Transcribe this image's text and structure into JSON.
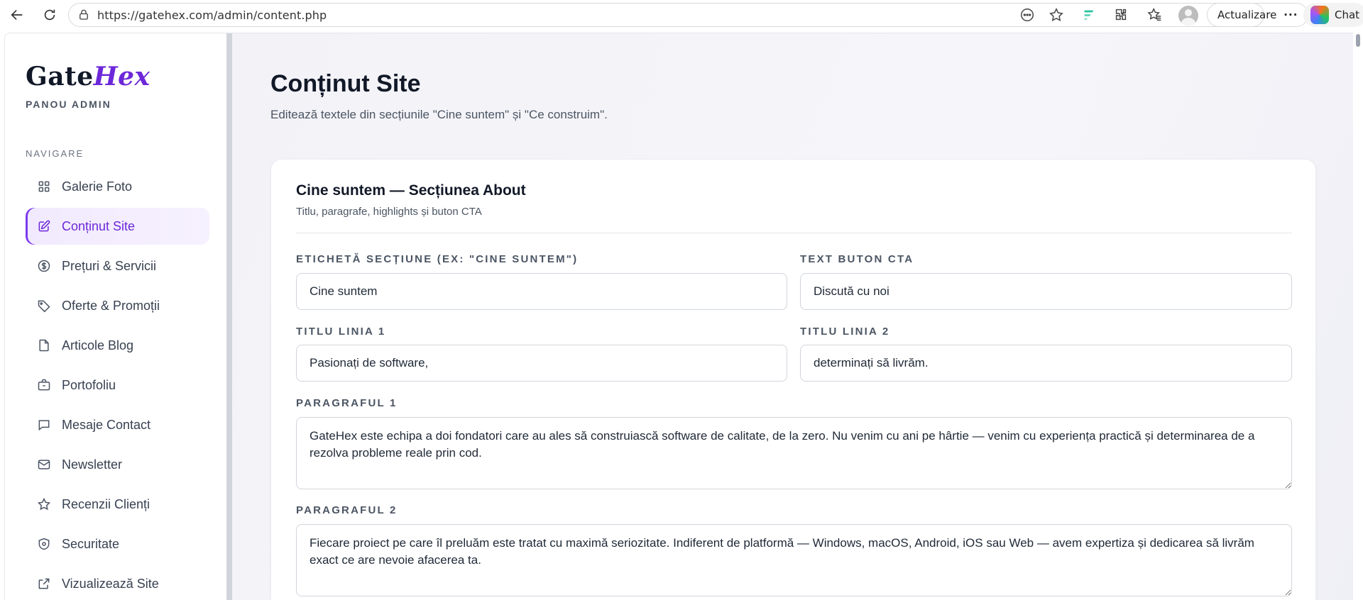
{
  "browser": {
    "url": "https://gatehex.com/admin/content.php",
    "update_label": "Actualizare",
    "update_more": "···",
    "chat_label": "Chat",
    "icons": [
      "back-icon",
      "reload-icon",
      "lock-icon",
      "reader-mode-icon",
      "star-icon",
      "extension-f-icon",
      "extensions-icon",
      "favorites-icon",
      "profile-icon",
      "copilot-icon"
    ]
  },
  "sidebar": {
    "brand_a": "Gate",
    "brand_b": "Hex",
    "subtitle": "PANOU ADMIN",
    "nav_heading": "NAVIGARE",
    "items": [
      {
        "label": "Galerie Foto",
        "icon": "grid-icon"
      },
      {
        "label": "Conținut Site",
        "icon": "edit-icon",
        "active": true
      },
      {
        "label": "Prețuri & Servicii",
        "icon": "dollar-icon"
      },
      {
        "label": "Oferte & Promoții",
        "icon": "tag-icon"
      },
      {
        "label": "Articole Blog",
        "icon": "file-icon"
      },
      {
        "label": "Portofoliu",
        "icon": "briefcase-icon"
      },
      {
        "label": "Mesaje Contact",
        "icon": "message-icon"
      },
      {
        "label": "Newsletter",
        "icon": "mail-icon"
      },
      {
        "label": "Recenzii Clienți",
        "icon": "star-icon"
      },
      {
        "label": "Securitate",
        "icon": "shield-icon"
      },
      {
        "label": "Vizualizează Site",
        "icon": "external-link-icon"
      }
    ]
  },
  "main": {
    "title": "Conținut Site",
    "subtitle": "Editează textele din secțiunile \"Cine suntem\" și \"Ce construim\".",
    "card": {
      "title": "Cine suntem — Secțiunea About",
      "subtitle": "Titlu, paragrafe, highlights și buton CTA",
      "fields": {
        "section_label": {
          "label": "ETICHETĂ SECȚIUNE (EX: \"CINE SUNTEM\")",
          "value": "Cine suntem"
        },
        "cta_text": {
          "label": "TEXT BUTON CTA",
          "value": "Discută cu noi"
        },
        "title_line1": {
          "label": "TITLU LINIA 1",
          "value": "Pasionați de software,"
        },
        "title_line2": {
          "label": "TITLU LINIA 2",
          "value": "determinați să livrăm."
        },
        "paragraph1": {
          "label": "PARAGRAFUL 1",
          "value": "GateHex este echipa a doi fondatori care au ales să construiască software de calitate, de la zero. Nu venim cu ani pe hârtie — venim cu experiența practică și determinarea de a rezolva probleme reale prin cod."
        },
        "paragraph2": {
          "label": "PARAGRAFUL 2",
          "value": "Fiecare proiect pe care îl preluăm este tratat cu maximă seriozitate. Indiferent de platformă — Windows, macOS, Android, iOS sau Web — avem expertiza și dedicarea să livrăm exact ce are nevoie afacerea ta."
        }
      }
    }
  },
  "colors": {
    "accent": "#6d28d9",
    "active_bg": "#f3ecfe",
    "page_bg": "#f3f4f8"
  }
}
